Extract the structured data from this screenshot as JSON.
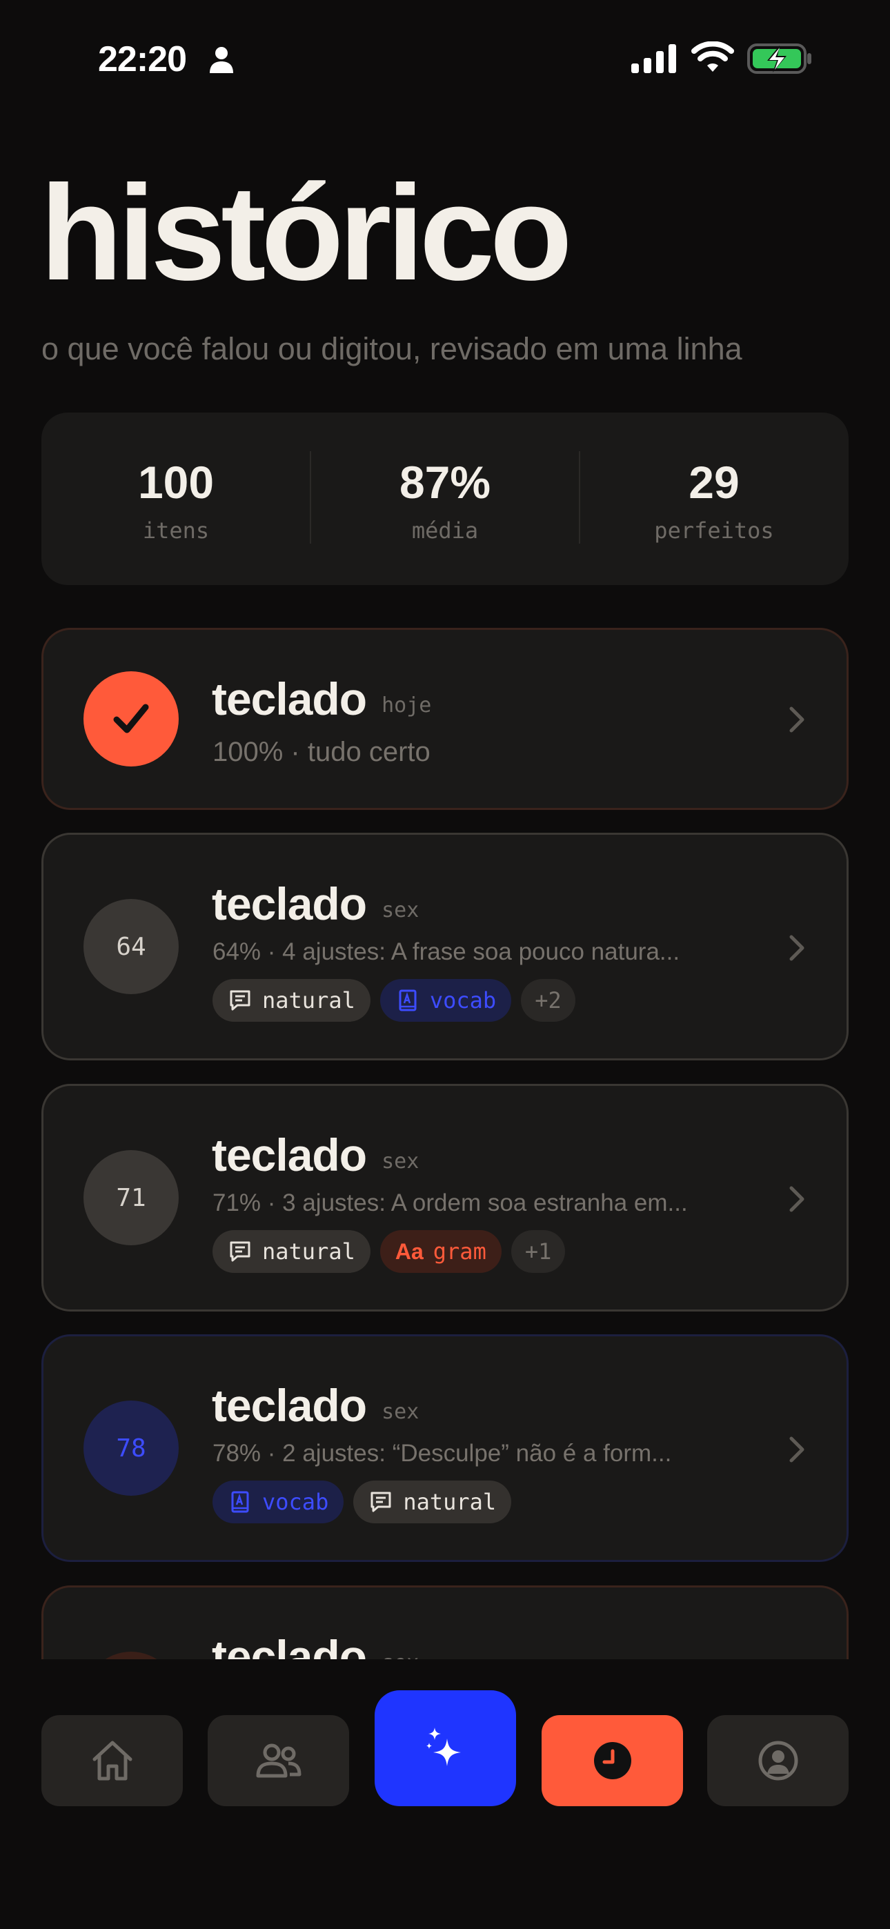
{
  "status_bar": {
    "time": "22:20"
  },
  "header": {
    "title": "histórico",
    "subtitle": "o que você falou ou digitou, revisado em uma linha"
  },
  "stats": [
    {
      "value": "100",
      "label": "itens"
    },
    {
      "value": "87%",
      "label": "média"
    },
    {
      "value": "29",
      "label": "perfeitos"
    }
  ],
  "entries": [
    {
      "title": "teclado",
      "when": "hoje",
      "score": "100",
      "score_icon": "check-icon",
      "summary": "100% · tudo certo",
      "tags": []
    },
    {
      "title": "teclado",
      "when": "sex",
      "score": "64",
      "summary": "64% · 4 ajustes: A frase soa pouco natura...",
      "tags": [
        {
          "label": "natural",
          "icon": "chat-icon"
        },
        {
          "label": "vocab",
          "icon": "book-icon"
        },
        {
          "label": "+2"
        }
      ]
    },
    {
      "title": "teclado",
      "when": "sex",
      "score": "71",
      "summary": "71% · 3 ajustes: A ordem soa estranha em...",
      "tags": [
        {
          "label": "natural",
          "icon": "chat-icon"
        },
        {
          "label": "gram",
          "icon_text": "Aa"
        },
        {
          "label": "+1"
        }
      ]
    },
    {
      "title": "teclado",
      "when": "sex",
      "score": "78",
      "summary": "78% · 2 ajustes: “Desculpe” não é a form...",
      "tags": [
        {
          "label": "vocab",
          "icon": "book-icon"
        },
        {
          "label": "natural",
          "icon": "chat-icon"
        }
      ]
    },
    {
      "title": "teclado",
      "when": "sex"
    }
  ],
  "tab_bar": {
    "items": [
      {
        "icon": "home-icon",
        "active": false
      },
      {
        "icon": "friends-icon",
        "active": false
      },
      {
        "icon": "sparkle-icon",
        "active": false
      },
      {
        "icon": "clock-icon",
        "active": true
      },
      {
        "icon": "profile-icon",
        "active": false
      }
    ]
  },
  "colors": {
    "background": "#0d0c0c",
    "card": "#1a1918",
    "accent_orange": "#ff5a3a",
    "accent_blue": "#1f35ff",
    "text_primary": "#f3efe8",
    "text_muted": "#6f6b66",
    "battery_green": "#34c759"
  }
}
